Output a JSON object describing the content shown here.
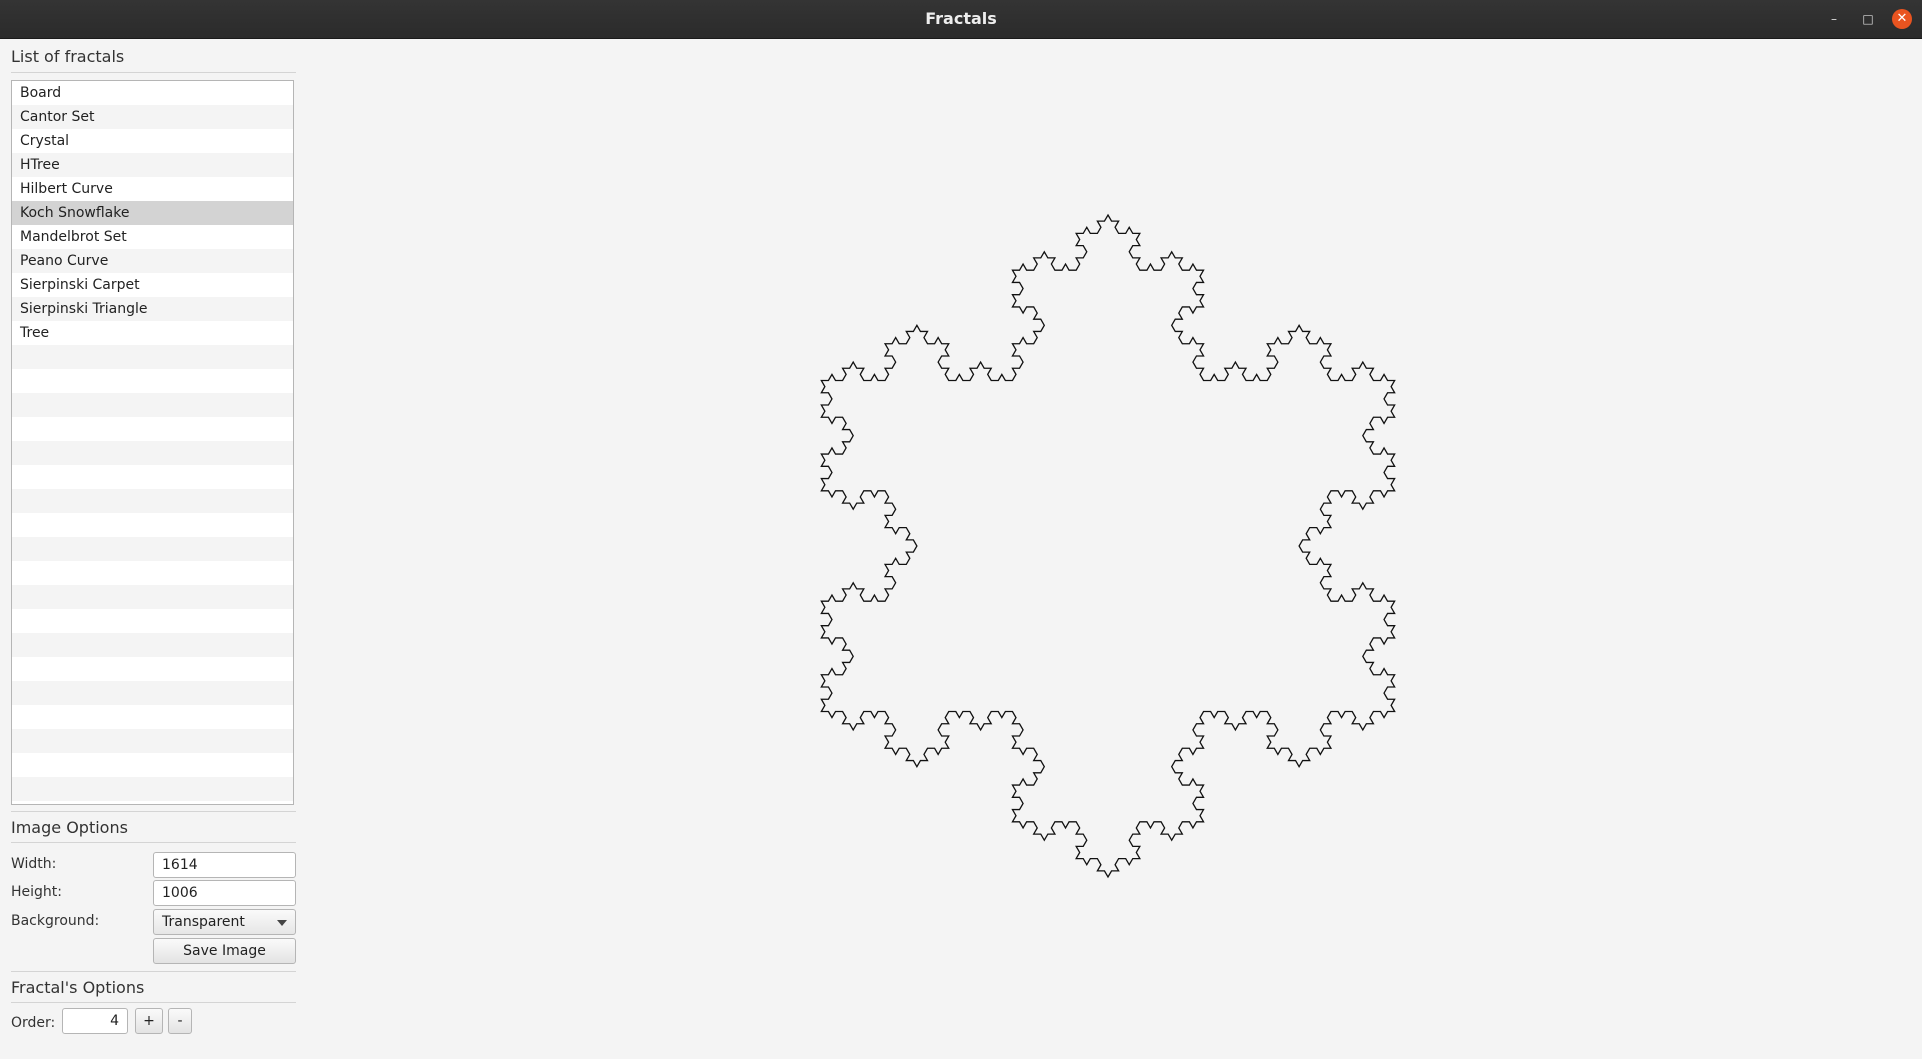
{
  "window": {
    "title": "Fractals",
    "minimize_icon": "–",
    "maximize_icon": "□",
    "close_icon": "✕"
  },
  "sidebar": {
    "list_title": "List of fractals",
    "fractals": [
      "Board",
      "Cantor Set",
      "Crystal",
      "HTree",
      "Hilbert Curve",
      "Koch Snowflake",
      "Mandelbrot Set",
      "Peano Curve",
      "Sierpinski Carpet",
      "Sierpinski Triangle",
      "Tree"
    ],
    "selected": "Koch Snowflake",
    "image_options": {
      "title": "Image Options",
      "width_label": "Width:",
      "width_value": "1614",
      "height_label": "Height:",
      "height_value": "1006",
      "background_label": "Background:",
      "background_value": "Transparent",
      "save_label": "Save Image"
    },
    "fractal_options": {
      "title": "Fractal's Options",
      "order_label": "Order:",
      "order_value": "4",
      "plus_label": "+",
      "minus_label": "-"
    }
  },
  "fractal": {
    "type": "Koch Snowflake",
    "order": 4,
    "stroke_color": "#111111"
  }
}
